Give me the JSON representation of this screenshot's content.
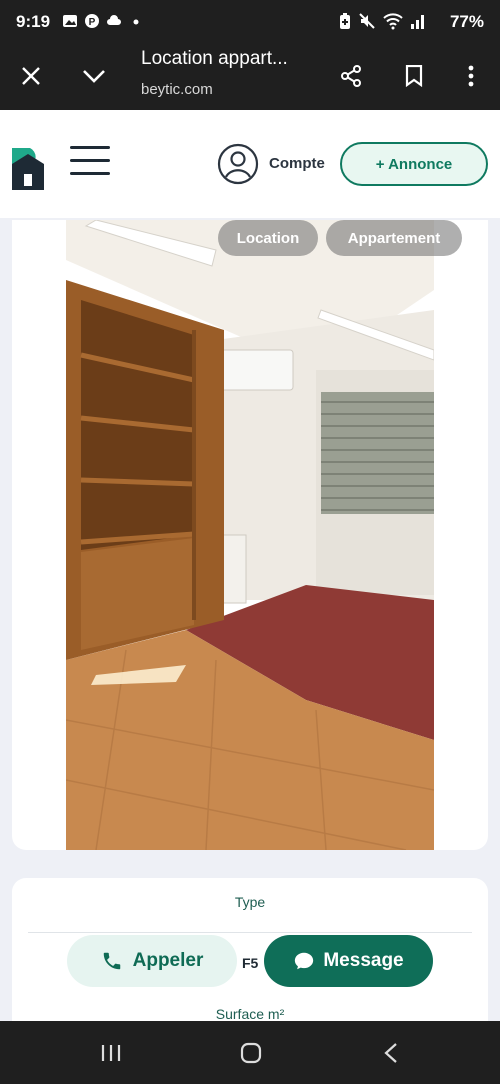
{
  "status_bar": {
    "time": "9:19",
    "battery": "77%",
    "icons": [
      "gallery-icon",
      "pinterest-icon",
      "cloud-icon",
      "dot-icon",
      "battery-saver-icon",
      "mute-icon",
      "wifi-icon",
      "signal-icon"
    ]
  },
  "browser": {
    "title": "Location appart...",
    "url": "beytic.com",
    "icons": [
      "close-icon",
      "chevron-down-icon",
      "share-icon",
      "bookmark-icon",
      "more-vert-icon"
    ]
  },
  "header": {
    "account_label": "Compte",
    "annonce_label": "+ Annonce",
    "brand_color": "#0f7a60"
  },
  "listing": {
    "tags": [
      "Location",
      "Appartement"
    ],
    "type_label": "Type",
    "type_value": "F5",
    "surface_label": "Surface m²",
    "call_label": "Appeler",
    "message_label": "Message"
  },
  "nav": {
    "icons": [
      "recents-icon",
      "home-icon",
      "back-icon"
    ]
  }
}
